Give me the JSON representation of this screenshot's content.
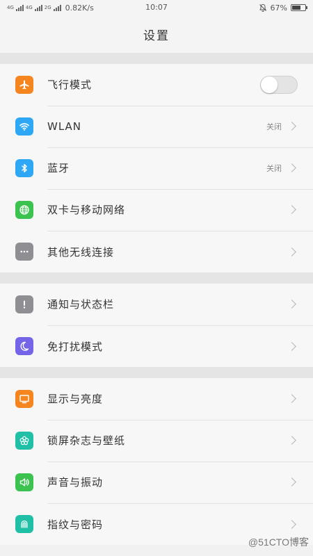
{
  "status_bar": {
    "network_1": "4G",
    "network_2": "4G",
    "network_3": "2G",
    "speed": "0.82K/s",
    "time": "10:07",
    "battery": "67%",
    "battery_level": 0.67
  },
  "header": {
    "title": "设置"
  },
  "sections": [
    {
      "items": [
        {
          "label": "飞行模式",
          "icon": "airplane-icon",
          "color": "#f5851f",
          "toggle": false
        },
        {
          "label": "WLAN",
          "icon": "wifi-icon",
          "color": "#2ea8f5",
          "value": "关闭"
        },
        {
          "label": "蓝牙",
          "icon": "bluetooth-icon",
          "color": "#2ea8f5",
          "value": "关闭"
        },
        {
          "label": "双卡与移动网络",
          "icon": "globe-icon",
          "color": "#3cc24f"
        },
        {
          "label": "其他无线连接",
          "icon": "more-icon",
          "color": "#8e8e93"
        }
      ]
    },
    {
      "items": [
        {
          "label": "通知与状态栏",
          "icon": "exclamation-icon",
          "color": "#8e8e93"
        },
        {
          "label": "免打扰模式",
          "icon": "moon-icon",
          "color": "#7464e8"
        }
      ]
    },
    {
      "items": [
        {
          "label": "显示与亮度",
          "icon": "display-icon",
          "color": "#f5851f"
        },
        {
          "label": "锁屏杂志与壁纸",
          "icon": "flower-icon",
          "color": "#1fc0a6"
        },
        {
          "label": "声音与振动",
          "icon": "speaker-icon",
          "color": "#3cc24f"
        },
        {
          "label": "指纹与密码",
          "icon": "fingerprint-icon",
          "color": "#1fc0a6"
        }
      ]
    }
  ],
  "watermark": "@51CTO博客"
}
